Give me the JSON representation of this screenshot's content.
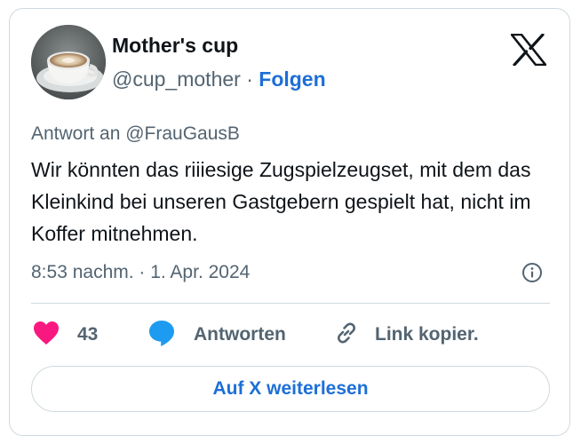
{
  "author": {
    "display_name": "Mother's cup",
    "handle": "@cup_mother",
    "separator": "·",
    "follow_label": "Folgen"
  },
  "tweet": {
    "reply_to": "Antwort an @FrauGausB",
    "text": "Wir könnten das riiiesige Zugspielzeugset, mit dem das Kleinkind bei unseren Gastgebern gespielt hat, nicht im Koffer mitnehmen.",
    "timestamp": "8:53 nachm. · 1. Apr. 2024"
  },
  "actions": {
    "like_count": "43",
    "reply_label": "Antworten",
    "copy_label": "Link kopier."
  },
  "read_more_label": "Auf X weiterlesen",
  "icons": {
    "avatar": "coffee-cup-photo",
    "brand": "x-logo-icon",
    "info": "info-icon",
    "like": "heart-icon",
    "reply": "speech-bubble-icon",
    "copy": "link-icon"
  },
  "colors": {
    "link_blue": "#1d6fd6",
    "heart_pink": "#f91880",
    "reply_blue": "#1d9bf0",
    "secondary_text": "#536471",
    "border": "#cfd9de"
  }
}
